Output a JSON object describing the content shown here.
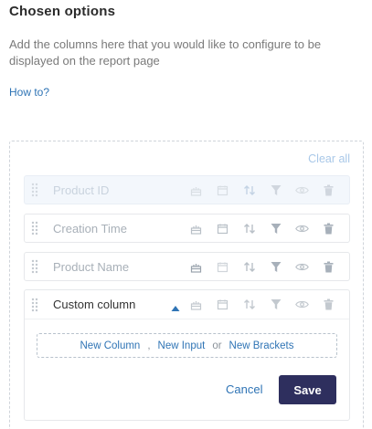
{
  "header": {
    "title": "Chosen options",
    "description": "Add the columns here that you would like to configure to be displayed on the report page",
    "how_to": "How to?"
  },
  "panel": {
    "clear_all": "Clear all",
    "columns": [
      {
        "label": "Product ID",
        "state": "dragging"
      },
      {
        "label": "Creation Time",
        "state": "default"
      },
      {
        "label": "Product Name",
        "state": "default"
      }
    ],
    "custom_column": {
      "label": "Custom column",
      "add_links": {
        "new_column": "New Column",
        "comma": ",",
        "new_input": "New Input",
        "or": "or",
        "new_brackets": "New Brackets"
      },
      "cancel_label": "Cancel",
      "save_label": "Save"
    }
  },
  "colors": {
    "link": "#2f74b5",
    "save_button": "#2e2f5e",
    "icon_gray": "#b9c0c7",
    "sort_icon_blue": "#8aa8c8"
  },
  "icons": [
    "drag-handle-icon",
    "cake-icon",
    "calendar-icon",
    "sort-icon",
    "filter-icon",
    "eye-icon",
    "trash-icon",
    "caret-up-icon"
  ]
}
